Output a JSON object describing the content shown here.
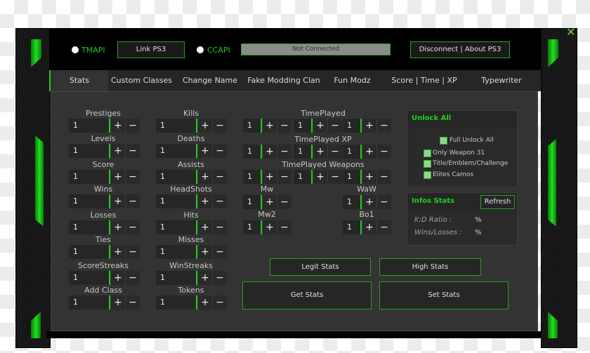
{
  "window": {
    "close_label": "✕"
  },
  "connection": {
    "tmapi_label": "TMAPI",
    "ccapi_label": "CCAPI",
    "link_button": "Link PS3",
    "status_text": "Not Connected",
    "disconnect_button": "Disconnect | About PS3"
  },
  "tabs": [
    {
      "label": "Stats",
      "active": true
    },
    {
      "label": "Custom Classes"
    },
    {
      "label": "Change Name"
    },
    {
      "label": "Fake Modding Clan"
    },
    {
      "label": "Fun Modz"
    },
    {
      "label": "Score | Time | XP"
    },
    {
      "label": "Typewriter"
    }
  ],
  "left_fields": [
    {
      "label": "Prestiges",
      "value": "1"
    },
    {
      "label": "Levels",
      "value": "1"
    },
    {
      "label": "Score",
      "value": "1"
    },
    {
      "label": "Wins",
      "value": "1"
    },
    {
      "label": "Losses",
      "value": "1"
    },
    {
      "label": "Ties",
      "value": "1"
    },
    {
      "label": "ScoreStreaks",
      "value": "1"
    },
    {
      "label": "Add Class",
      "value": "1"
    }
  ],
  "mid_fields": [
    {
      "label": "Kills",
      "value": "1"
    },
    {
      "label": "Deaths",
      "value": "1"
    },
    {
      "label": "Assists",
      "value": "1"
    },
    {
      "label": "HeadShots",
      "value": "1"
    },
    {
      "label": "Hits",
      "value": "1"
    },
    {
      "label": "Misses",
      "value": "1"
    },
    {
      "label": "WinStreaks",
      "value": "1"
    },
    {
      "label": "Tokens",
      "value": "1"
    }
  ],
  "time_groups": [
    {
      "label": "TimePlayed",
      "values": [
        "1",
        "1",
        "1"
      ]
    },
    {
      "label": "TimePlayed XP",
      "values": [
        "1",
        "1",
        "1"
      ]
    },
    {
      "label": "TimePlayed Weapons",
      "values": [
        "1",
        "1",
        "1"
      ]
    }
  ],
  "game_fields": [
    {
      "label": "Mw",
      "value": "1"
    },
    {
      "label": "WaW",
      "value": "1"
    },
    {
      "label": "Mw2",
      "value": "1"
    },
    {
      "label": "Bo1",
      "value": "1"
    }
  ],
  "spin": {
    "plus": "+",
    "minus": "−"
  },
  "unlock_all": {
    "title": "Unlock All",
    "full_unlock": "Full Unlock All",
    "options": [
      "Only Weapon 31",
      "Title/Emblem/Challenge",
      "Elites Camos"
    ]
  },
  "infos_stats": {
    "title": "Infos Stats",
    "refresh_button": "Refresh",
    "kd_label": "K:D Ratio :",
    "kd_value": "%",
    "wl_label": "Wins/Losses :",
    "wl_value": "%"
  },
  "actions": {
    "legit_stats": "Legit Stats",
    "high_stats": "High Stats",
    "get_stats": "Get Stats",
    "set_stats": "Set Stats"
  },
  "colors": {
    "accent": "#1ec81e",
    "panel": "#333333",
    "frame": "#000000"
  }
}
